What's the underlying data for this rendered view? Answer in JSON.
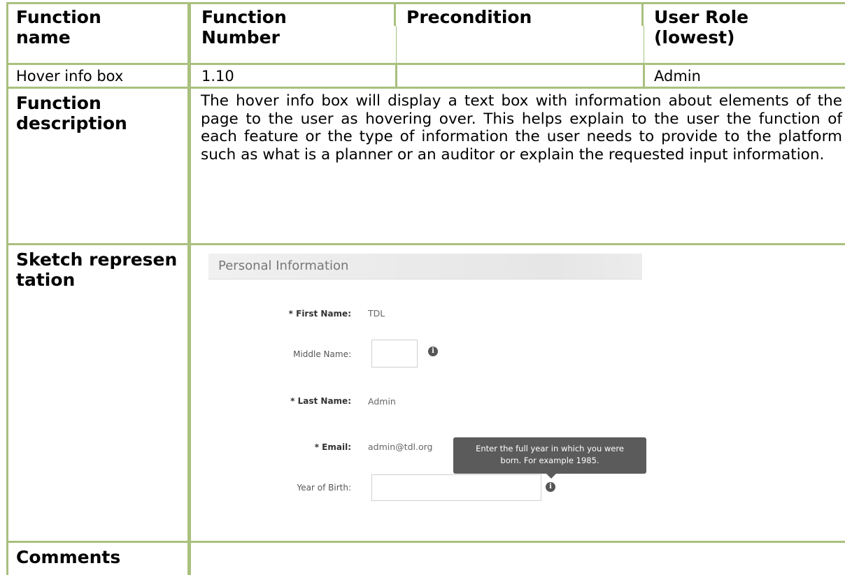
{
  "table": {
    "headers": {
      "function_name": "Function name",
      "function_number": "Function Number",
      "precondition": "Precondition",
      "user_role": "User Role (lowest)"
    },
    "row": {
      "function_name": "Hover info box",
      "function_number": "1.10",
      "precondition": "",
      "user_role": "Admin"
    },
    "description_label": "Function description",
    "description": "The hover info box will display a text box with information about elements of the page to the user as hovering over. This helps explain to the user the function of each feature or the type of information the user needs to provide to the platform such as what is a planner or an auditor or explain the requested input information.",
    "sketch_label": "Sketch representation",
    "comments_label": "Comments",
    "comments": ""
  },
  "sketch": {
    "section_title": "Personal Information",
    "fields": {
      "first_name_label": "* First Name:",
      "first_name_value": "TDL",
      "middle_name_label": "Middle Name:",
      "middle_name_value": "",
      "last_name_label": "* Last Name:",
      "last_name_value": "Admin",
      "email_label": "* Email:",
      "email_value": "admin@tdl.org",
      "year_of_birth_label": "Year of Birth:",
      "year_of_birth_value": ""
    },
    "tooltip": {
      "line1": "Enter the full year in which you were",
      "line2": "born. For example 1985."
    },
    "info_icon": "info-icon"
  },
  "colors": {
    "grid": "#a9c07e",
    "tooltip_bg": "#5b5b5b"
  }
}
